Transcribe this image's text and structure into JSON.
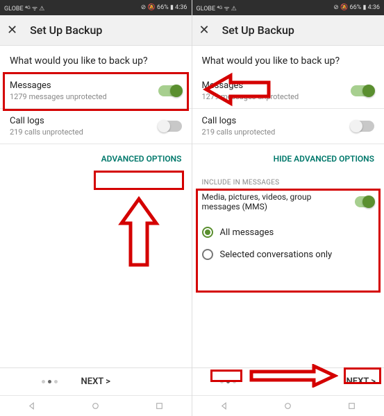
{
  "status": {
    "left": "GLOBE ⁴ᴳ ᯤ ⚠",
    "right": "⊘ 🔕 66% ▮ 4:36"
  },
  "appbar": {
    "close": "✕",
    "title": "Set Up Backup"
  },
  "question": "What would you like to back up?",
  "items": {
    "messages": {
      "title": "Messages",
      "sub": "1279 messages unprotected"
    },
    "calllogs": {
      "title": "Call logs",
      "sub": "219 calls unprotected"
    }
  },
  "adv": {
    "show": "ADVANCED OPTIONS",
    "hide": "HIDE ADVANCED OPTIONS",
    "header": "INCLUDE IN MESSAGES",
    "media": "Media, pictures, videos, group messages (MMS)",
    "all": "All messages",
    "selected": "Selected conversations only"
  },
  "footer": {
    "next": "NEXT >"
  }
}
